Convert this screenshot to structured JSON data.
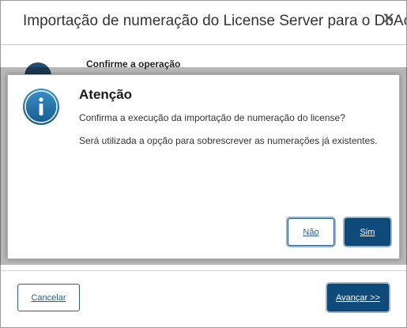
{
  "window": {
    "title": "Importação de numeração do License Server para o DbAccess",
    "close_glyph": "✕"
  },
  "background": {
    "heading": "Confirme a operação"
  },
  "footer": {
    "cancel_label": "Cancelar",
    "next_label": "Avançar >>"
  },
  "modal": {
    "icon": "info-icon",
    "title": "Atenção",
    "message_1": "Confirma a execução da importação de numeração do license?",
    "message_2": "Será utilizada a opção para sobrescrever as numerações já existentes.",
    "no_label": "Não",
    "yes_label": "Sim"
  },
  "colors": {
    "primary": "#0f4b7a",
    "accent_border": "#2b5f86",
    "icon_fill": "#1d6fa3"
  }
}
